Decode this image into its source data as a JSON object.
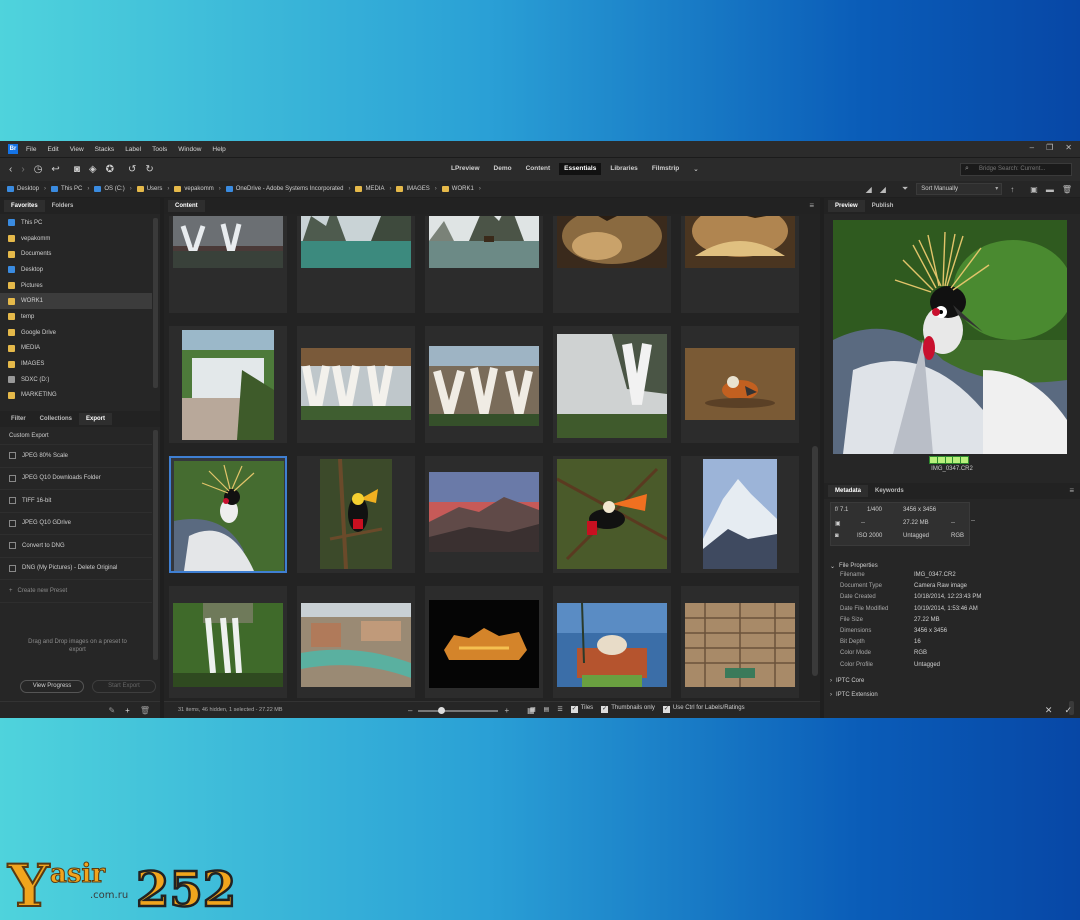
{
  "colors": {
    "accent": "#3f7fd2",
    "background": "#1f1f1f",
    "panel": "#262626"
  },
  "menu": [
    "File",
    "Edit",
    "View",
    "Stacks",
    "Label",
    "Tools",
    "Window",
    "Help"
  ],
  "workspaces": [
    "LPreview",
    "Demo",
    "Content",
    "Essentials",
    "Libraries",
    "Filmstrip"
  ],
  "active_workspace": "Essentials",
  "search_placeholder": "Bridge Search: Current...",
  "breadcrumbs": [
    "Desktop",
    "This PC",
    "OS (C:)",
    "Users",
    "vepakomm",
    "OneDrive - Adobe Systems Incorporated",
    "MEDIA",
    "IMAGES",
    "WORK1"
  ],
  "sort": "Sort Manually",
  "left_tabs": [
    "Favorites",
    "Folders"
  ],
  "favorites": [
    "This PC",
    "vepakomm",
    "Documents",
    "Desktop",
    "Pictures",
    "WORK1",
    "temp",
    "Google Drive",
    "MEDIA",
    "IMAGES",
    "SDXC (D:)",
    "MARKETING"
  ],
  "export_tabs": [
    "Filter",
    "Collections",
    "Export"
  ],
  "export_presets": [
    "Custom Export",
    "JPEG 80% Scale",
    "JPEG Q10 Downloads Folder",
    "TIFF 16-bit",
    "JPEG Q10 GDrive",
    "Convert to DNG",
    "DNG (My Pictures) - Delete Original"
  ],
  "create_preset": "Create new Preset",
  "drop_note": "Drag and Drop images on a preset to export",
  "view_progress": "View Progress",
  "start_export": "Start Export",
  "content_tab": "Content",
  "status_text": "31 items, 46 hidden, 1 selected - 27.22 MB",
  "view_options": {
    "tiles": "Tiles",
    "thumbnails_only": "Thumbnails only",
    "ctrl_labels": "Use Ctrl for Labels/Ratings"
  },
  "right_tabs": [
    "Preview",
    "Publish"
  ],
  "preview_filename": "IMG_0347.CR2",
  "meta_tabs": [
    "Metadata",
    "Keywords"
  ],
  "camera": {
    "aperture": "f/ 7.1",
    "shutter": "1/400",
    "dash1": "--",
    "dash2": "--",
    "iso": "ISO 2000",
    "dims": "3456 x 3456",
    "size": "27.22 MB",
    "dash3": "--",
    "profile": "Untagged",
    "mode": "RGB"
  },
  "file_props_title": "File Properties",
  "file_props": [
    {
      "k": "Filename",
      "v": "IMG_0347.CR2"
    },
    {
      "k": "Document Type",
      "v": "Camera Raw image"
    },
    {
      "k": "Date Created",
      "v": "10/18/2014, 12:23:43 PM"
    },
    {
      "k": "Date File Modified",
      "v": "10/19/2014, 1:53:46 AM"
    },
    {
      "k": "File Size",
      "v": "27.22 MB"
    },
    {
      "k": "Dimensions",
      "v": "3456 x 3456"
    },
    {
      "k": "Bit Depth",
      "v": "16"
    },
    {
      "k": "Color Mode",
      "v": "RGB"
    },
    {
      "k": "Color Profile",
      "v": "Untagged"
    }
  ],
  "sections": [
    "IPTC Core",
    "IPTC Extension"
  ],
  "thumbnails": [
    "waterfall-sunset",
    "lake-cliffs",
    "boat-cliffs",
    "cave-1",
    "cave-2",
    "falls-1",
    "falls-2",
    "falls-3",
    "falls-mist",
    "mandarin-duck",
    "crowned-crane",
    "toucan-1",
    "mountain-sunset",
    "toucan-2",
    "snowy-peak",
    "jungle-falls",
    "river-town",
    "lit-fort",
    "tomb",
    "stepwell"
  ],
  "watermark": {
    "brand": "Yasir",
    "num": "252",
    "domain": ".com.ru"
  }
}
